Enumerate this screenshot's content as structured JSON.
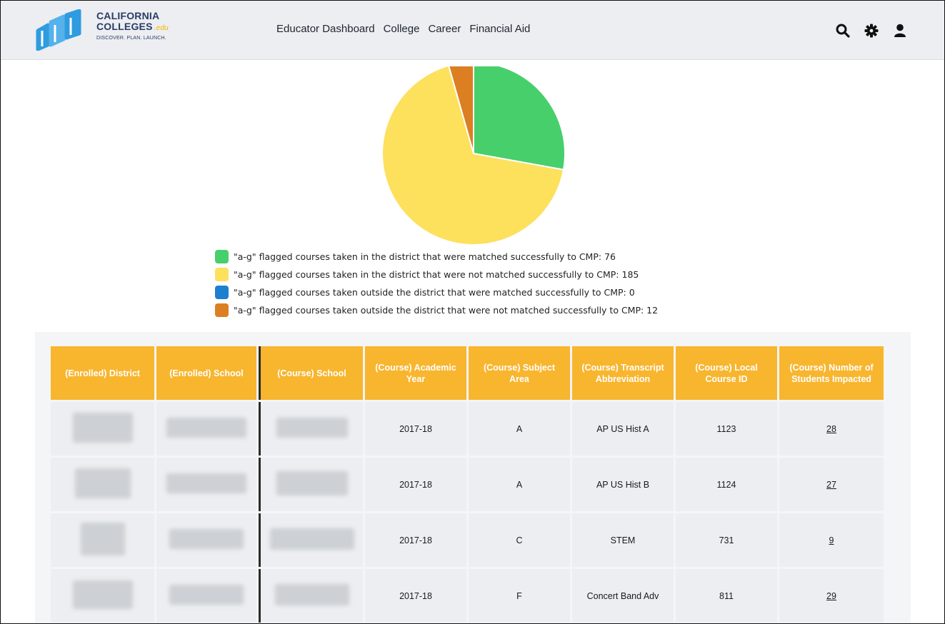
{
  "header": {
    "logo": {
      "line1": "CALIFORNIA",
      "line2": "COLLEGES",
      "edu": ".edu",
      "tagline": "DISCOVER. PLAN. LAUNCH."
    },
    "nav": [
      "Educator Dashboard",
      "College",
      "Career",
      "Financial Aid"
    ],
    "icons": [
      "search-icon",
      "gear-icon",
      "user-icon"
    ]
  },
  "chart_data": {
    "type": "pie",
    "slices": [
      {
        "label": "\"a-g\" flagged courses taken in the district that were matched successfully to CMP: 76",
        "value": 76,
        "color": "#47cf6c"
      },
      {
        "label": "\"a-g\" flagged courses taken in the district that were not matched successfully to CMP: 185",
        "value": 185,
        "color": "#fde05c"
      },
      {
        "label": "\"a-g\" flagged courses taken outside the district that were matched successfully to CMP: 0",
        "value": 0,
        "color": "#1d7fd0"
      },
      {
        "label": "\"a-g\" flagged courses taken outside the district that were not matched successfully to CMP: 12",
        "value": 12,
        "color": "#dc7f22"
      }
    ],
    "legend_position": "bottom"
  },
  "table": {
    "headers": [
      "(Enrolled) District",
      "(Enrolled) School",
      "(Course) School",
      "(Course) Academic Year",
      "(Course) Subject Area",
      "(Course) Transcript Abbreviation",
      "(Course) Local Course ID",
      "(Course) Number of Students Impacted"
    ],
    "rows": [
      {
        "year": "2017-18",
        "subject": "A",
        "abbrev": "AP US Hist A",
        "course_id": "1123",
        "students": "28"
      },
      {
        "year": "2017-18",
        "subject": "A",
        "abbrev": "AP US Hist B",
        "course_id": "1124",
        "students": "27"
      },
      {
        "year": "2017-18",
        "subject": "C",
        "abbrev": "STEM",
        "course_id": "731",
        "students": "9"
      },
      {
        "year": "2017-18",
        "subject": "F",
        "abbrev": "Concert Band Adv",
        "course_id": "811",
        "students": "29"
      }
    ]
  }
}
